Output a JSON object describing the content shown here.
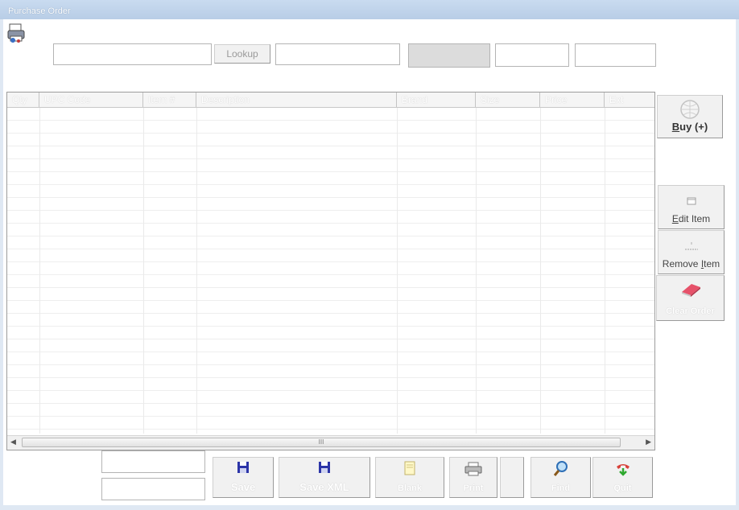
{
  "window": {
    "title": "Purchase Order"
  },
  "header": {
    "field1": "",
    "lookup_label": "Lookup",
    "field2": "",
    "field3": "",
    "field4": "",
    "field5": ""
  },
  "grid": {
    "columns": [
      "Qty",
      "UPC Code",
      "Item #",
      "Description",
      "Brand",
      "Size",
      "Price",
      "Ext"
    ],
    "scroll_grip": "III"
  },
  "side": {
    "buy": {
      "key": "B",
      "rest": "uy (+)"
    },
    "edit": {
      "key": "E",
      "rest": "dit Item"
    },
    "remove": {
      "pre": "Remove ",
      "key": "I",
      "rest": "tem"
    },
    "clear": "Clear Order"
  },
  "footer": {
    "field1": "",
    "field2": "",
    "save": "Save",
    "save_xml": "Save XML",
    "blank": "Blank",
    "print": "Print",
    "find": "Find",
    "quit": "Quit"
  }
}
